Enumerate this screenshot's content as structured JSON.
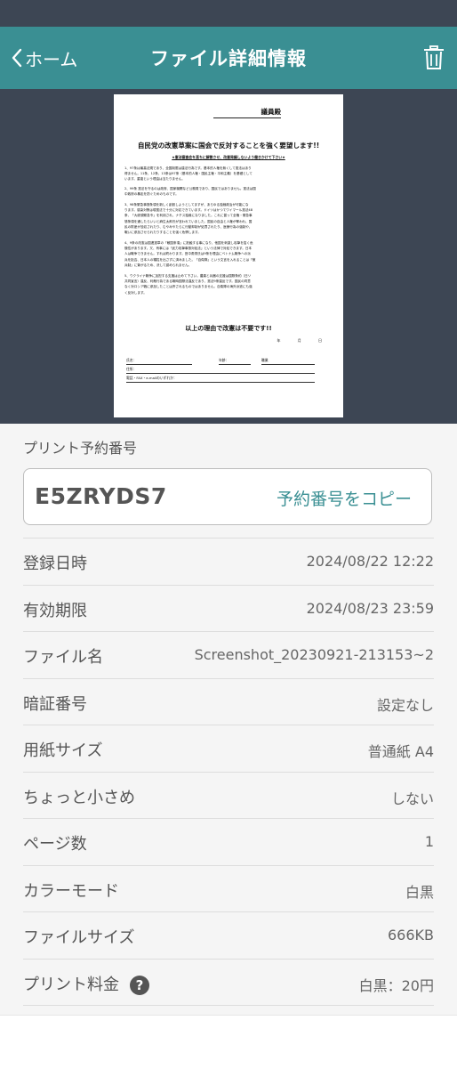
{
  "header": {
    "back_label": "ホーム",
    "title": "ファイル詳細情報"
  },
  "document": {
    "addressee": "議員殿",
    "title": "自民党の改憲草案に国会で反対することを強く要望します!!",
    "subtitle": "★憲法審査会を直ちに解散させ、改憲発議しないよう働きかけて下さい★",
    "paragraphs": [
      "1、97条は最高法規であり、全国制限は違法行為です。基本的人権を無くして憲法はあり\n得ません。11条、12条、13条は97条（基本的人権・国民主権・平和主義）を基礎として\nいます。重複という理由は当たりません。",
      "2、99条 憲法を守るのは政府、国家機関など公務員であり、国民ではありません。憲法は国\n中政府の暴走を防ぐためのものです。",
      "3、98条緊急事態条項を新しく創設しようとしてますが、あらゆる独裁政治が可能にな\nります。感染対策は現憲法で十分に対応できています。ドイツはかつてワイマール憲法48\n条、「大統領緊急令」を利用され、ナチス独裁になりました。これに習って全権・緊急事\n態条項を通したらいいと麻生太郎氏が言われていました。国民の自由と人権が奪われ、国\n民の財産が没収されたり、むやみやたらに行動抑制が処罰されたり、医療行為の強制や、\n戦いに参加させられたりすることを強く危惧します。",
      "4、9条の改憲は国連憲章の「敵国条項」に抵触する事になり、他国を刺激し攻撃を招く危\n険性があります。又、有事には「武力攻撃事態対処法」という法律で対処できます。日本\n人は戦争できません。すれば終わります。田中角栄氏は9条を理由にベトナム戦争への派\n兵を拒否、日本人の犠牲を出さずに済みました。「自衛隊」という文言を入れることは「徴\n兵制」に繋がるため、決して認められません。",
      "5、ウクライナ戦争に加担する支援は止めて下さい。農薬と兵器の支援は国際条約（日ソ\n共同宣言）違反、利敵行為である戦時国際法違反であり、憲法9条違反です。国民の同意\nなく対ロシア戦に参加したことは許されるものではありません。自衛隊の海外派遣にも強\nく反対します。"
    ],
    "closing": "以上の理由で改憲は不要です!!",
    "date_line": "年 月 日",
    "form_name": "氏名：",
    "form_age": "年齢：",
    "form_job": "職業",
    "form_address": "住所：",
    "form_contact": "電話・FAX・e-mailのいずれか："
  },
  "reservation": {
    "label": "プリント予約番号",
    "code": "E5ZRYDS7",
    "copy_label": "予約番号をコピー"
  },
  "details": [
    {
      "label": "登録日時",
      "value": "2024/08/22 12:22"
    },
    {
      "label": "有効期限",
      "value": "2024/08/23 23:59"
    },
    {
      "label": "ファイル名",
      "value": "Screenshot_20230921-213153~2"
    },
    {
      "label": "暗証番号",
      "value": "設定なし"
    },
    {
      "label": "用紙サイズ",
      "value": "普通紙 A4"
    },
    {
      "label": "ちょっと小さめ",
      "value": "しない"
    },
    {
      "label": "ページ数",
      "value": "1"
    },
    {
      "label": "カラーモード",
      "value": "白黒"
    },
    {
      "label": "ファイルサイズ",
      "value": "666KB"
    },
    {
      "label": "プリント料金",
      "value": "白黒：20円"
    }
  ],
  "colors": {
    "header_bg": "#3a8f93",
    "dark_bg": "#3d4654",
    "accent": "#3a8f93"
  },
  "icons": {
    "back": "chevron-left-icon",
    "trash": "trash-icon",
    "help": "question-circle-icon"
  }
}
